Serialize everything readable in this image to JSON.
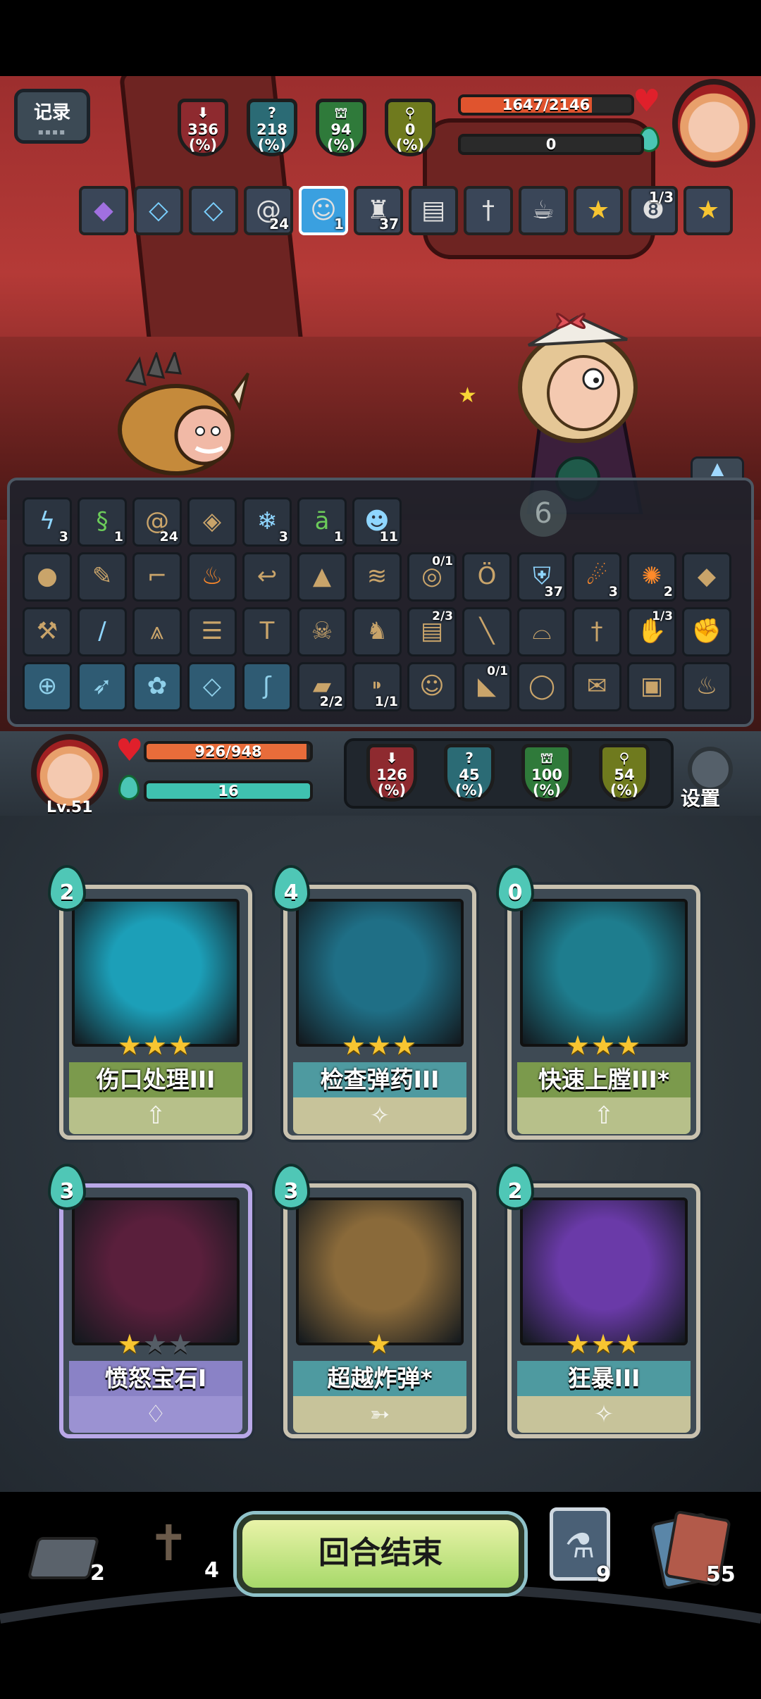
{
  "top_hud": {
    "record_label": "记录",
    "enemy_stats": [
      {
        "icon": "attack-down-shield-icon",
        "value": "336",
        "unit": "(%)",
        "color": "#8e2a2f"
      },
      {
        "icon": "mystery-shield-icon",
        "value": "218",
        "unit": "(%)",
        "color": "#2b6b75"
      },
      {
        "icon": "defense-shield-icon",
        "value": "94",
        "unit": "(%)",
        "color": "#2f7a3a"
      },
      {
        "icon": "speed-shield-icon",
        "value": "0",
        "unit": "(%)",
        "color": "#6f7a1e"
      }
    ],
    "enemy_hp": "1647/2146",
    "enemy_hp_fraction": 0.767,
    "enemy_energy": "0"
  },
  "enemy_buffs": [
    {
      "icon": "purple-crystal-icon",
      "count": ""
    },
    {
      "icon": "blue-crystal-icon",
      "count": ""
    },
    {
      "icon": "blue-crystal-icon",
      "count": ""
    },
    {
      "icon": "vortex-icon",
      "count": "24"
    },
    {
      "icon": "ghost-icon",
      "count": "1"
    },
    {
      "icon": "hooded-figure-icon",
      "count": "37"
    },
    {
      "icon": "book-icon",
      "count": ""
    },
    {
      "icon": "dagger-icon",
      "count": ""
    },
    {
      "icon": "teacup-icon",
      "count": ""
    },
    {
      "icon": "star-wand-icon",
      "count": ""
    },
    {
      "icon": "eight-ball-icon",
      "count": "1/3"
    },
    {
      "icon": "star-wand-icon",
      "count": ""
    }
  ],
  "relic_rows": [
    [
      {
        "icon": "lightning-icon",
        "count": "3",
        "top": ""
      },
      {
        "icon": "green-serpent-icon",
        "count": "1",
        "top": ""
      },
      {
        "icon": "vortex-icon",
        "count": "24",
        "top": ""
      },
      {
        "icon": "gem-shield-icon",
        "count": "",
        "top": ""
      },
      {
        "icon": "snowflake-icon",
        "count": "3",
        "top": ""
      },
      {
        "icon": "green-rune-icon",
        "count": "1",
        "top": ""
      },
      {
        "icon": "masked-face-icon",
        "count": "11",
        "top": ""
      }
    ],
    [
      {
        "icon": "pouch-icon",
        "count": "",
        "top": ""
      },
      {
        "icon": "feather-icon",
        "count": "",
        "top": ""
      },
      {
        "icon": "gun-icon",
        "count": "",
        "top": ""
      },
      {
        "icon": "flame-apple-icon",
        "count": "",
        "top": ""
      },
      {
        "icon": "hook-icon",
        "count": "",
        "top": ""
      },
      {
        "icon": "helmet-icon",
        "count": "",
        "top": ""
      },
      {
        "icon": "wings-icon",
        "count": "",
        "top": ""
      },
      {
        "icon": "galaxy-icon",
        "count": "",
        "top": "0/1"
      },
      {
        "icon": "owl-icon",
        "count": "",
        "top": ""
      },
      {
        "icon": "blue-shield-icon",
        "count": "37",
        "top": ""
      },
      {
        "icon": "fire-comet-icon",
        "count": "3",
        "top": ""
      },
      {
        "icon": "flame-burst-icon",
        "count": "2",
        "top": ""
      },
      {
        "icon": "glowing-gem-icon",
        "count": "",
        "top": ""
      }
    ],
    [
      {
        "icon": "axe-icon",
        "count": "",
        "top": ""
      },
      {
        "icon": "blue-blade-icon",
        "count": "",
        "top": ""
      },
      {
        "icon": "witch-hat-icon",
        "count": "",
        "top": ""
      },
      {
        "icon": "scroll-icon",
        "count": "",
        "top": ""
      },
      {
        "icon": "hammer-icon",
        "count": "",
        "top": ""
      },
      {
        "icon": "skull-pile-icon",
        "count": "",
        "top": ""
      },
      {
        "icon": "knight-icon",
        "count": "",
        "top": ""
      },
      {
        "icon": "spellbook-icon",
        "count": "",
        "top": "2/3"
      },
      {
        "icon": "staff-icon",
        "count": "",
        "top": ""
      },
      {
        "icon": "viking-helmet-icon",
        "count": "",
        "top": ""
      },
      {
        "icon": "sword-icon",
        "count": "",
        "top": ""
      },
      {
        "icon": "glove-icon",
        "count": "",
        "top": "1/3"
      },
      {
        "icon": "boxing-glove-icon",
        "count": "",
        "top": ""
      }
    ],
    [
      {
        "icon": "locked-target-icon",
        "count": "",
        "top": "",
        "locked": true
      },
      {
        "icon": "locked-bow-icon",
        "count": "",
        "top": "",
        "locked": true
      },
      {
        "icon": "locked-rose-icon",
        "count": "",
        "top": "",
        "locked": true
      },
      {
        "icon": "locked-crystal-icon",
        "count": "",
        "top": "",
        "locked": true
      },
      {
        "icon": "locked-claw-icon",
        "count": "",
        "top": "",
        "locked": true
      },
      {
        "icon": "golden-cannon-icon",
        "count": "2/2",
        "top": ""
      },
      {
        "icon": "bullet-icon",
        "count": "1/1",
        "top": ""
      },
      {
        "icon": "dwarf-icon",
        "count": "",
        "top": ""
      },
      {
        "icon": "cleaver-icon",
        "count": "",
        "top": "0/1"
      },
      {
        "icon": "frying-pan-icon",
        "count": "",
        "top": ""
      },
      {
        "icon": "rolled-scroll-icon",
        "count": "",
        "top": ""
      },
      {
        "icon": "box-robot-icon",
        "count": "",
        "top": ""
      },
      {
        "icon": "meat-icon",
        "count": "",
        "top": ""
      }
    ]
  ],
  "player_hud": {
    "level": "Lv.51",
    "hp": "926/948",
    "hp_fraction": 0.977,
    "energy": "16",
    "stats": [
      {
        "icon": "attack-down-shield-icon",
        "value": "126",
        "unit": "(%)",
        "color": "#8e2a2f"
      },
      {
        "icon": "mystery-shield-icon",
        "value": "45",
        "unit": "(%)",
        "color": "#2b6b75"
      },
      {
        "icon": "defense-shield-icon",
        "value": "100",
        "unit": "(%)",
        "color": "#2f7a3a"
      },
      {
        "icon": "speed-shield-icon",
        "value": "54",
        "unit": "(%)",
        "color": "#6f7a1e"
      }
    ],
    "settings_label": "设置"
  },
  "cards": [
    {
      "name": "伤口处理III",
      "cost": "2",
      "stars": 3,
      "max_stars": 3,
      "foot_icon": "upgrade-arrow-icon",
      "band": "#7b9a4c",
      "foot_bg": "#b7c08a",
      "art_bg": "#1c9fb8",
      "art_glyph": "bandaged-arm-icon"
    },
    {
      "name": "检查弹药III",
      "cost": "4",
      "stars": 3,
      "max_stars": 3,
      "foot_icon": "buff-spark-icon",
      "band": "#4e9aa0",
      "foot_bg": "#c7c39a",
      "art_bg": "#1f6f86",
      "art_glyph": "shadow-figure-icon"
    },
    {
      "name": "快速上膛III*",
      "cost": "0",
      "stars": 3,
      "max_stars": 3,
      "foot_icon": "upgrade-arrow-icon",
      "band": "#7b9a4c",
      "foot_bg": "#b7c08a",
      "art_bg": "#1e7d8e",
      "art_glyph": "cannonball-icon"
    },
    {
      "name": "愤怒宝石I",
      "cost": "3",
      "stars": 1,
      "max_stars": 3,
      "foot_icon": "diamond-icon",
      "band": "#8a82c6",
      "foot_bg": "#9b92d2",
      "art_bg": "#5a1f3c",
      "art_glyph": "rage-gem-icon"
    },
    {
      "name": "超越炸弹*",
      "cost": "3",
      "stars": 1,
      "max_stars": 1,
      "foot_icon": "throw-icon",
      "band": "#4e9aa0",
      "foot_bg": "#c7c39a",
      "art_bg": "#8a6a3a",
      "art_glyph": "bomb-icon"
    },
    {
      "name": "狂暴III",
      "cost": "2",
      "stars": 3,
      "max_stars": 3,
      "foot_icon": "buff-spark-icon",
      "band": "#4e9aa0",
      "foot_bg": "#c7c39a",
      "art_bg": "#6a3aa8",
      "art_glyph": "berserk-figure-icon"
    }
  ],
  "bottom_bar": {
    "exhaust_pile": "2",
    "grave_pile": "4",
    "end_turn_label": "回合结束",
    "potion_count": "9",
    "draw_pile": "55"
  },
  "colors": {
    "hp_red": "#e0542e",
    "energy_teal": "#3fc1b0",
    "player_hp_orange": "#e86c3a"
  }
}
